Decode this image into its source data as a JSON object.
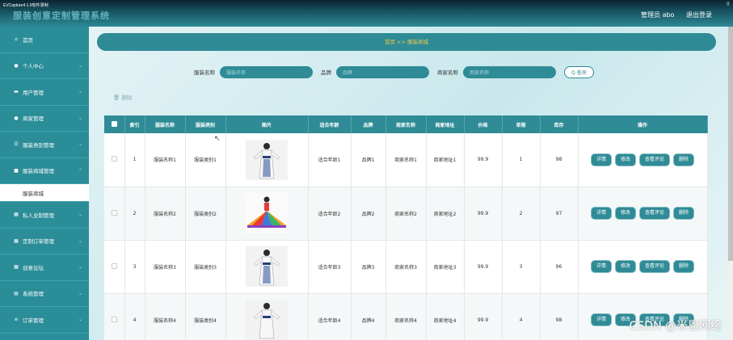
{
  "capture_label": "EVCapture4.1.9软件录制",
  "app_title": "服装创意定制管理系统",
  "header": {
    "admin": "管理员 abo",
    "logout": "退出登录"
  },
  "sidebar": {
    "items": [
      {
        "label": "首页",
        "icon": "home-icon"
      },
      {
        "label": "个人中心",
        "icon": "user-icon"
      },
      {
        "label": "用户管理",
        "icon": "card-icon"
      },
      {
        "label": "商家管理",
        "icon": "pin-icon"
      },
      {
        "label": "服装类别管理",
        "icon": "list-icon"
      },
      {
        "label": "服装商城管理",
        "icon": "doc-icon"
      },
      {
        "label": "服装商城",
        "sub": true
      },
      {
        "label": "私人业制管理",
        "icon": "grid-icon"
      },
      {
        "label": "定制订单管理",
        "icon": "grid-icon"
      },
      {
        "label": "创意论坛",
        "icon": "grid-icon"
      },
      {
        "label": "系统管理",
        "icon": "db-icon"
      },
      {
        "label": "订单管理",
        "icon": "menu-icon"
      }
    ]
  },
  "breadcrumb": {
    "home": "首页",
    "sep": ">>",
    "current": "服装商城"
  },
  "search": {
    "name_label": "服装名称",
    "name_placeholder": "服装名称",
    "brand_label": "品牌",
    "brand_placeholder": "品牌",
    "merchant_label": "商家名称",
    "merchant_placeholder": "商家名称",
    "button": "Q 查询"
  },
  "actions": {
    "delete": "删除"
  },
  "table": {
    "headers": [
      "索引",
      "服装名称",
      "服装类别",
      "图片",
      "适合年龄",
      "品牌",
      "商家名称",
      "商家地址",
      "价格",
      "单限",
      "库存",
      "操作"
    ],
    "rows": [
      {
        "index": "1",
        "name": "服装名称1",
        "category": "服装类别1",
        "age": "适合年龄1",
        "brand": "品牌1",
        "merchant": "商家名称1",
        "address": "商家地址1",
        "price": "99.9",
        "limit": "1",
        "stock": "98"
      },
      {
        "index": "2",
        "name": "服装名称2",
        "category": "服装类别2",
        "age": "适合年龄2",
        "brand": "品牌2",
        "merchant": "商家名称2",
        "address": "商家地址2",
        "price": "99.9",
        "limit": "2",
        "stock": "97"
      },
      {
        "index": "3",
        "name": "服装名称3",
        "category": "服装类别3",
        "age": "适合年龄3",
        "brand": "品牌3",
        "merchant": "商家名称3",
        "address": "商家地址3",
        "price": "99.9",
        "limit": "3",
        "stock": "96"
      },
      {
        "index": "4",
        "name": "服装名称4",
        "category": "服装类别4",
        "age": "适合年龄4",
        "brand": "品牌4",
        "merchant": "商家名称4",
        "address": "商家地址4",
        "price": "99.9",
        "limit": "4",
        "stock": "98"
      }
    ],
    "ops": {
      "detail": "详情",
      "edit": "修改",
      "review": "查看评论",
      "delete": "删除"
    }
  },
  "watermark": "CSDN @米恩网络",
  "colors": {
    "teal": "#2f8b96",
    "sidebar": "#2a8d98",
    "crumb_text": "#f2c94c"
  }
}
